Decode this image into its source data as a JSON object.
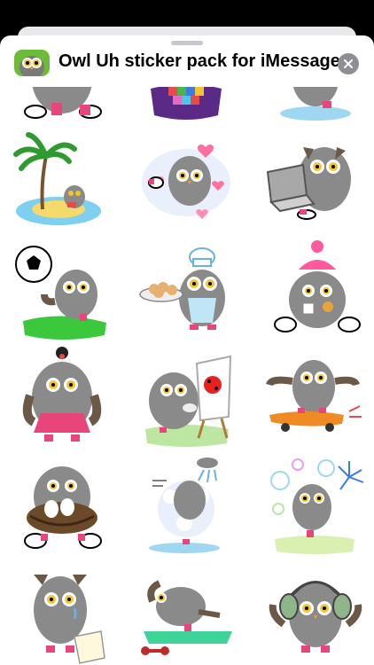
{
  "header": {
    "title": "Owl Uh sticker pack for iMessage",
    "app_icon": "owl-app-icon",
    "close_icon": "close-x-icon"
  },
  "stickers": [
    {
      "name": "owl-pink-shoes-partial"
    },
    {
      "name": "owl-quilt-partial"
    },
    {
      "name": "owl-puddle-partial"
    },
    {
      "name": "owl-island-palm-tree"
    },
    {
      "name": "owl-love-hearts"
    },
    {
      "name": "owl-laptop"
    },
    {
      "name": "owl-soccer-ball"
    },
    {
      "name": "owl-chef-cookies"
    },
    {
      "name": "owl-winter-hat-cocoa"
    },
    {
      "name": "owl-topknot-pink-skirt"
    },
    {
      "name": "owl-painting-ladybug"
    },
    {
      "name": "owl-skateboard"
    },
    {
      "name": "owl-nest-eggs"
    },
    {
      "name": "owl-shower"
    },
    {
      "name": "owl-bubbles-fireworks"
    },
    {
      "name": "owl-crying-paper"
    },
    {
      "name": "owl-yoga-mat-dumbbell"
    },
    {
      "name": "owl-headphones"
    }
  ],
  "colors": {
    "owl_body": "#8a8a8a",
    "owl_wing": "#6b5846",
    "eye_yellow": "#f4c430",
    "shoe_pink": "#e8457a",
    "sheet_bg": "#ffffff"
  }
}
